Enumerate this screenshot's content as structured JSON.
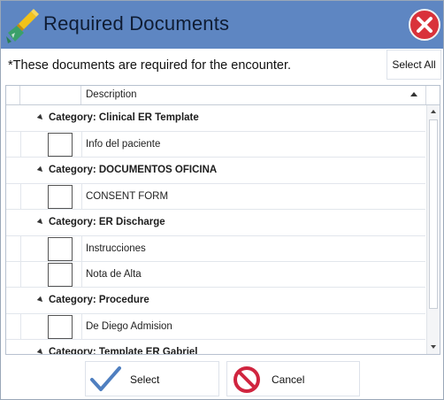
{
  "window": {
    "title": "Required Documents",
    "icons": {
      "app": "paint-brush-icon",
      "close": "close-icon"
    },
    "accent_color": "#5e86c2"
  },
  "notice": "*These documents are required for the encounter.",
  "toolbar": {
    "select_all_label": "Select All"
  },
  "grid": {
    "column_header": "Description",
    "sort": "ascending",
    "rows": [
      {
        "type": "category",
        "label": "Category: Clinical ER Template"
      },
      {
        "type": "item",
        "label": "Info del paciente",
        "checked": false
      },
      {
        "type": "category",
        "label": "Category: DOCUMENTOS OFICINA"
      },
      {
        "type": "item",
        "label": "CONSENT FORM",
        "checked": false
      },
      {
        "type": "category",
        "label": "Category: ER Discharge"
      },
      {
        "type": "item",
        "label": "Instrucciones",
        "checked": false
      },
      {
        "type": "item",
        "label": "Nota de Alta",
        "checked": false
      },
      {
        "type": "category",
        "label": "Category: Procedure"
      },
      {
        "type": "item",
        "label": "De Diego Admision",
        "checked": false
      },
      {
        "type": "category",
        "label": "Category: Template ER Gabriel"
      }
    ]
  },
  "buttons": {
    "select_label": "Select",
    "cancel_label": "Cancel",
    "select_icon": "checkmark-icon",
    "cancel_icon": "prohibited-icon"
  }
}
